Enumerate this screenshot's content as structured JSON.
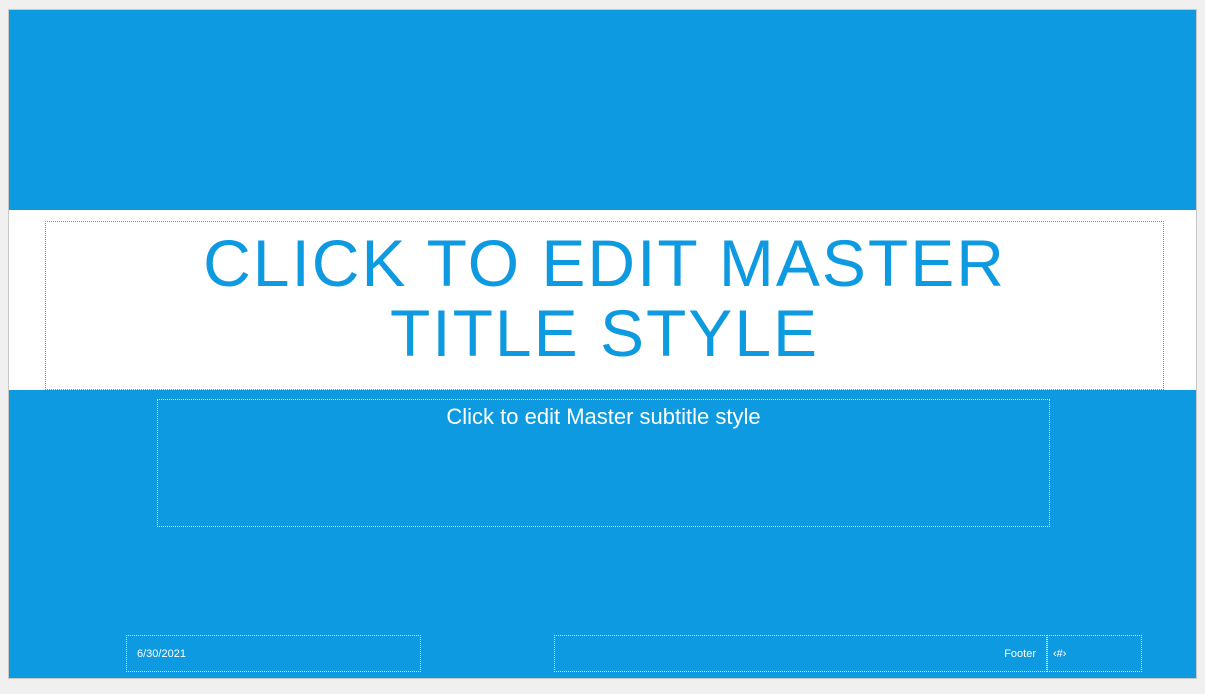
{
  "slide": {
    "title": "CLICK TO EDIT MASTER TITLE STYLE",
    "subtitle": "Click to edit Master subtitle style",
    "date": "6/30/2021",
    "footer": "Footer",
    "slide_number": "‹#›"
  },
  "colors": {
    "background": "#0d9ae0",
    "title_band": "#ffffff",
    "title_text": "#0d9ae0",
    "body_text": "#ffffff"
  }
}
